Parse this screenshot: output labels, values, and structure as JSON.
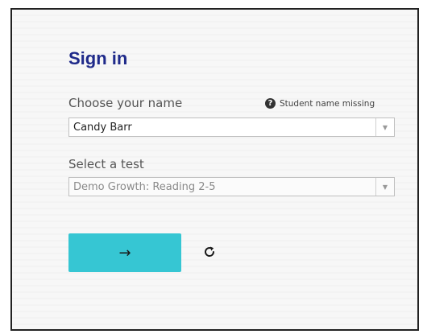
{
  "signin": {
    "title": "Sign in",
    "name_label": "Choose your name",
    "name_hint": "Student name missing",
    "name_hint_icon": "question-circle-icon",
    "name_value": "Candy Barr",
    "test_label": "Select a test",
    "test_value": "Demo Growth: Reading 2-5",
    "submit_icon": "arrow-right-icon",
    "submit_glyph": "→",
    "refresh_icon": "refresh-icon"
  },
  "colors": {
    "title": "#1f2a8a",
    "submit_button": "#36c6d3"
  }
}
